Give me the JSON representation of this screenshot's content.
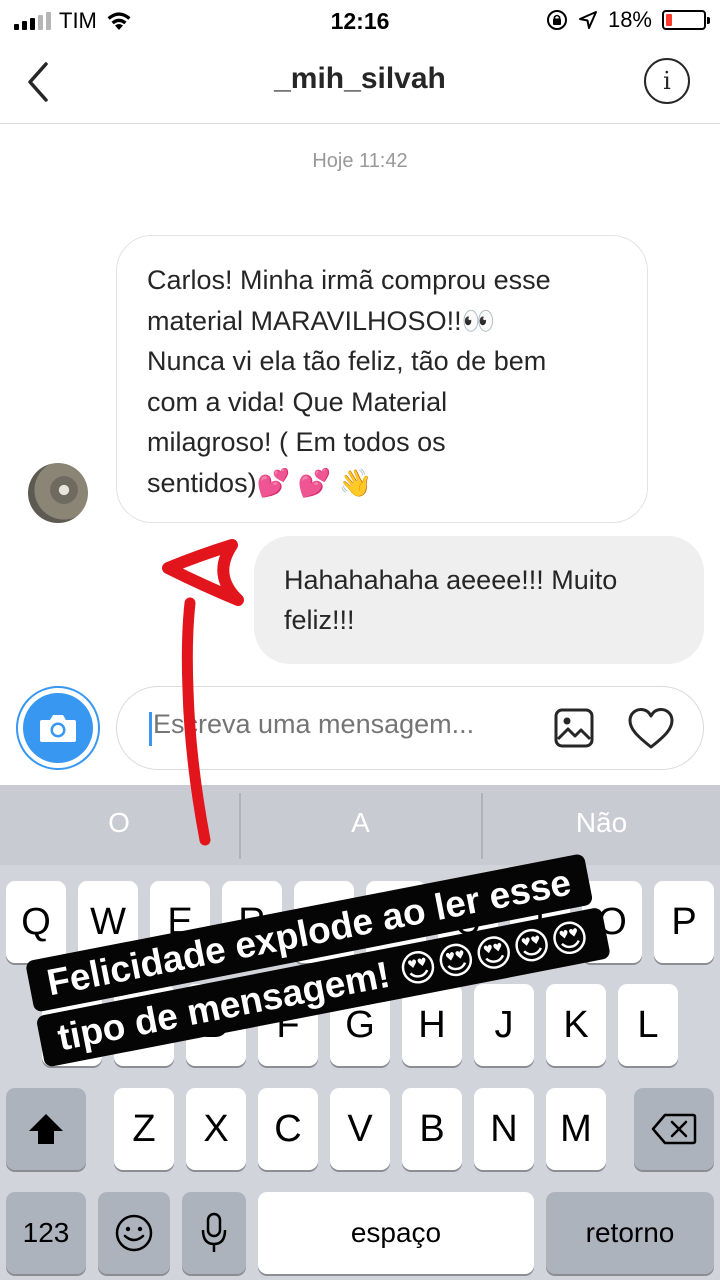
{
  "status_bar": {
    "carrier": "TIM",
    "time": "12:16",
    "battery_percent": "18%",
    "battery_level": 0.18,
    "icons": [
      "signal-icon",
      "wifi-icon",
      "orientation-lock-icon",
      "location-icon",
      "battery-icon"
    ]
  },
  "header": {
    "title": "_mih_silvah",
    "back_icon": "back-chevron-icon",
    "info_icon": "info-icon",
    "info_glyph": "i"
  },
  "chat": {
    "date_label": "Hoje 11:42",
    "incoming": {
      "text": "Carlos! Minha irmã comprou esse\nmaterial MARAVILHOSO!!👀\nNunca vi ela tão feliz, tão de bem\ncom a vida! Que Material\nmilagroso! ( Em todos os\nsentidos)💕 💕 👋"
    },
    "outgoing": {
      "text": "Hahahahaha aeeee!!! Muito\nfeliz!!!"
    }
  },
  "composer": {
    "placeholder": "Escreva uma mensagem...",
    "camera_icon": "camera-icon",
    "gallery_icon": "gallery-icon",
    "heart_icon": "heart-icon"
  },
  "keyboard": {
    "suggestions": [
      "O",
      "A",
      "Não"
    ],
    "row1": [
      "Q",
      "W",
      "E",
      "R",
      "T",
      "Y",
      "U",
      "I",
      "O",
      "P"
    ],
    "row2": [
      "A",
      "S",
      "D",
      "F",
      "G",
      "H",
      "J",
      "K",
      "L"
    ],
    "row3": [
      "Z",
      "X",
      "C",
      "V",
      "B",
      "N",
      "M"
    ],
    "numbers_key": "123",
    "space_key": "espaço",
    "return_key": "retorno",
    "icons": [
      "shift-icon",
      "backspace-icon",
      "emoji-icon",
      "microphone-icon"
    ]
  },
  "overlay": {
    "line1": "Felicidade explode ao ler esse",
    "line2": "tipo de mensagem! 😍😍😍😍😍",
    "arrow_color": "#e3151c"
  },
  "colors": {
    "accent": "#3897f0",
    "bubble_outgoing": "#efefef",
    "keyboard_bg": "#d1d4da"
  }
}
